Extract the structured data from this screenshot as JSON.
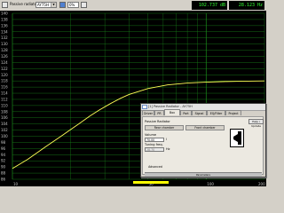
{
  "toolbar": {
    "select_label": "Passive radiator",
    "select_value": "AY75H",
    "zoom_value": "0%",
    "readout_spl": "102.737 dB",
    "readout_freq": "28.123 Hz"
  },
  "plot": {
    "y_ticks": [
      "140",
      "138",
      "136",
      "134",
      "132",
      "130",
      "128",
      "126",
      "124",
      "122",
      "120",
      "118",
      "116",
      "114",
      "112",
      "110",
      "108",
      "106",
      "104",
      "102",
      "100",
      "98",
      "96",
      "94",
      "92",
      "90",
      "88",
      "86"
    ],
    "x_ticks": [
      "10",
      "50",
      "100",
      "200"
    ],
    "colors": {
      "background": "#000000",
      "grid": "#1a8a1a",
      "curve": "#ffff55",
      "marker": "#ffff00"
    }
  },
  "chart_data": {
    "type": "line",
    "xlabel": "",
    "ylabel": "",
    "x_scale": "log",
    "xlim": [
      10,
      200
    ],
    "ylim": [
      86,
      140
    ],
    "series": [
      {
        "x": [
          10,
          12,
          15,
          18,
          20,
          22,
          25,
          28,
          32,
          36,
          40,
          50,
          63,
          80,
          100,
          125,
          150,
          200
        ],
        "values": [
          89.5,
          92.5,
          96.8,
          100.2,
          102.2,
          104.0,
          106.5,
          108.5,
          110.6,
          112.3,
          113.6,
          115.5,
          116.7,
          117.3,
          117.6,
          117.8,
          117.9,
          118.0
        ]
      }
    ]
  },
  "dialog": {
    "title": "[1] Passive Radiator - AY75H",
    "tabs": [
      "Driver",
      "PR",
      "Box",
      "Port",
      "Signal",
      "EQ/Filter",
      "Project"
    ],
    "active_tab": "Box",
    "section_label": "Passive Radiator",
    "inner_tabs": [
      "Rear chamber",
      "Front chamber"
    ],
    "volume_label": "Volume",
    "volume_value": "70.00",
    "volume_unit": "l",
    "tuning_label": "Tuning freq.",
    "tuning_value": "28.70",
    "tuning_unit": "Hz",
    "help_button": "Help / Update",
    "advanced_button": "Advanced",
    "footer_button": "Parameters"
  }
}
